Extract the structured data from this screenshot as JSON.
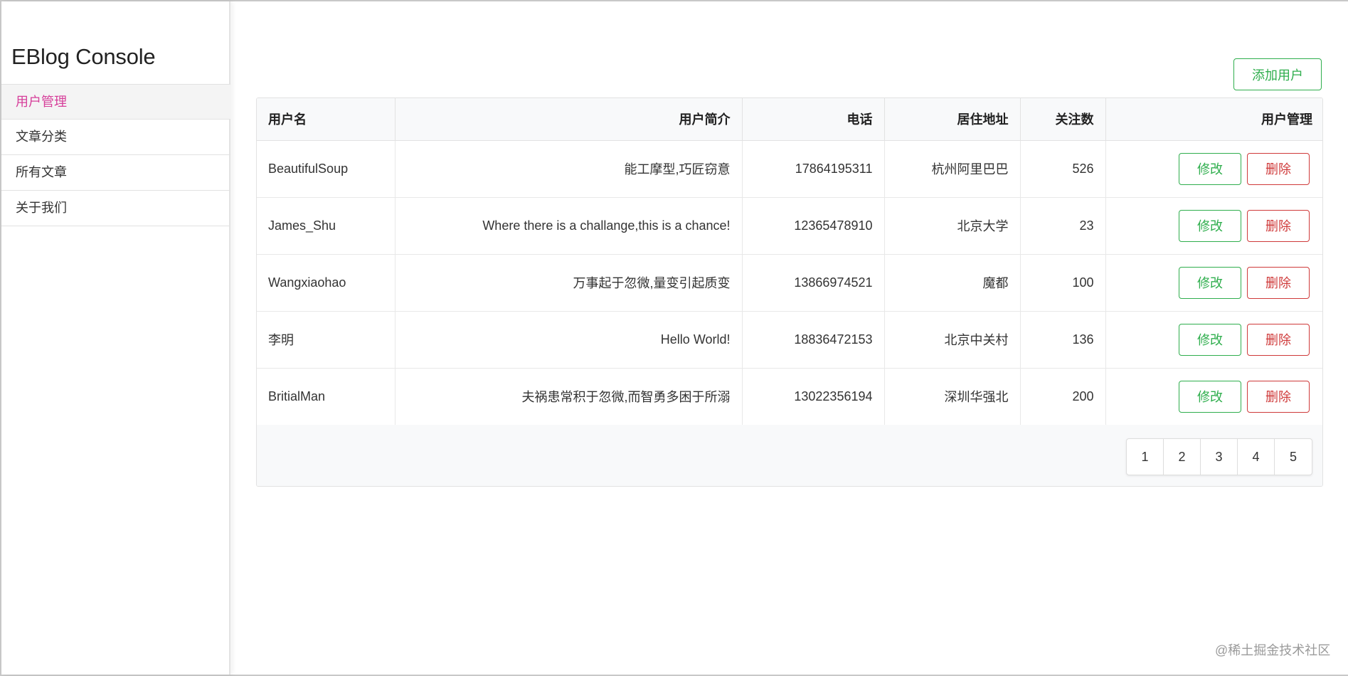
{
  "app": {
    "title": "EBlog Console"
  },
  "sidebar": {
    "items": [
      {
        "label": "用户管理",
        "active": true
      },
      {
        "label": "文章分类",
        "active": false
      },
      {
        "label": "所有文章",
        "active": false
      },
      {
        "label": "关于我们",
        "active": false
      }
    ]
  },
  "toolbar": {
    "add_user_label": "添加用户"
  },
  "table": {
    "headers": [
      "用户名",
      "用户简介",
      "电话",
      "居住地址",
      "关注数",
      "用户管理"
    ],
    "rows": [
      {
        "username": "BeautifulSoup",
        "bio": "能工摩型,巧匠窃意",
        "phone": "17864195311",
        "address": "杭州阿里巴巴",
        "follows": "526",
        "edit": "修改",
        "delete": "删除"
      },
      {
        "username": "James_Shu",
        "bio": "Where there is a challange,this is a chance!",
        "phone": "12365478910",
        "address": "北京大学",
        "follows": "23",
        "edit": "修改",
        "delete": "删除"
      },
      {
        "username": "Wangxiaohao",
        "bio": "万事起于忽微,量变引起质变",
        "phone": "13866974521",
        "address": "魔都",
        "follows": "100",
        "edit": "修改",
        "delete": "删除"
      },
      {
        "username": "李明",
        "bio": "Hello World!",
        "phone": "18836472153",
        "address": "北京中关村",
        "follows": "136",
        "edit": "修改",
        "delete": "删除"
      },
      {
        "username": "BritialMan",
        "bio": "夫祸患常积于忽微,而智勇多困于所溺",
        "phone": "13022356194",
        "address": "深圳华强北",
        "follows": "200",
        "edit": "修改",
        "delete": "删除"
      }
    ]
  },
  "pagination": {
    "pages": [
      "1",
      "2",
      "3",
      "4",
      "5"
    ]
  },
  "watermark": "@稀土掘金技术社区",
  "colors": {
    "accent_green": "#2fae4d",
    "danger_red": "#cf3a3a",
    "active_nav": "#d63e9a"
  }
}
